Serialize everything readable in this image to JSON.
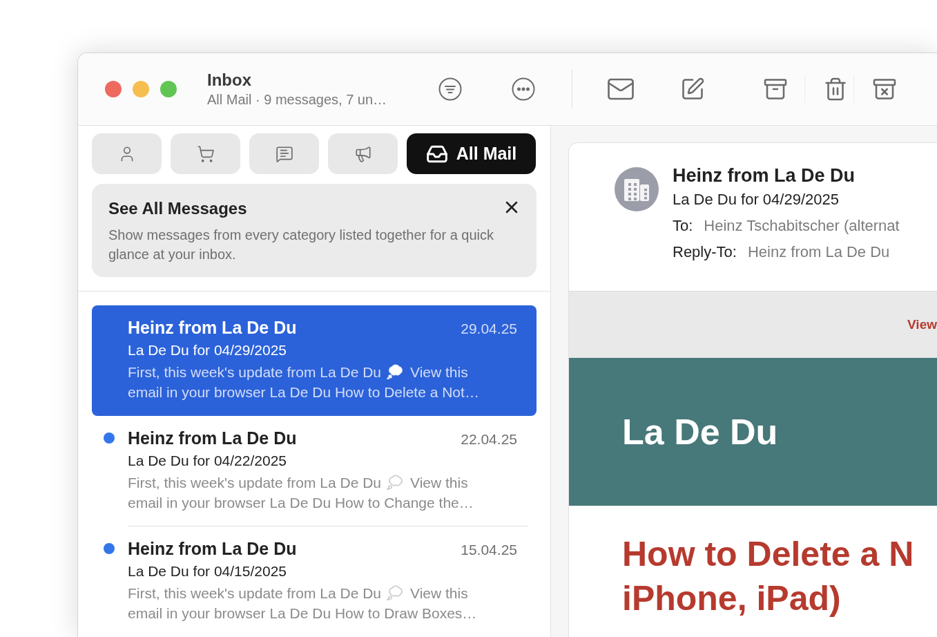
{
  "toolbar": {
    "title": "Inbox",
    "subtitle": "All Mail · 9 messages, 7 un…"
  },
  "category_tabs": [
    {
      "kind": "person",
      "selected": false
    },
    {
      "kind": "shopping",
      "selected": false
    },
    {
      "kind": "chat",
      "selected": false
    },
    {
      "kind": "promo",
      "selected": false
    },
    {
      "kind": "all",
      "label": "All Mail",
      "selected": true
    }
  ],
  "tip": {
    "title": "See All Messages",
    "text": "Show messages from every category listed together for a quick glance at your inbox."
  },
  "messages": [
    {
      "sender": "Heinz from La De Du",
      "date": "29.04.25",
      "subject": "La De Du for 04/29/2025",
      "preview_start": "First, this week's update from La De Du",
      "preview_end": "View this",
      "preview_line2": "email in your browser La De Du How to Delete a Not…",
      "selected": true,
      "unread": false
    },
    {
      "sender": "Heinz from La De Du",
      "date": "22.04.25",
      "subject": "La De Du for 04/22/2025",
      "preview_start": "First, this week's update from La De Du",
      "preview_end": "View this",
      "preview_line2": "email in your browser La De Du How to Change the…",
      "selected": false,
      "unread": true
    },
    {
      "sender": "Heinz from La De Du",
      "date": "15.04.25",
      "subject": "La De Du for 04/15/2025",
      "preview_start": "First, this week's update from La De Du",
      "preview_end": "View this",
      "preview_line2": "email in your browser La De Du How to Draw Boxes…",
      "selected": false,
      "unread": true
    }
  ],
  "reader": {
    "sender": "Heinz from La De Du",
    "subject": "La De Du for 04/29/2025",
    "to_label": "To:",
    "to": "Heinz Tschabitscher (alternat",
    "reply_to_label": "Reply-To:",
    "reply_to": "Heinz from La De Du",
    "banner_link": "View",
    "newsletter_title": "La De Du",
    "headline": [
      "How to Delete a N",
      "iPhone, iPad)"
    ]
  }
}
